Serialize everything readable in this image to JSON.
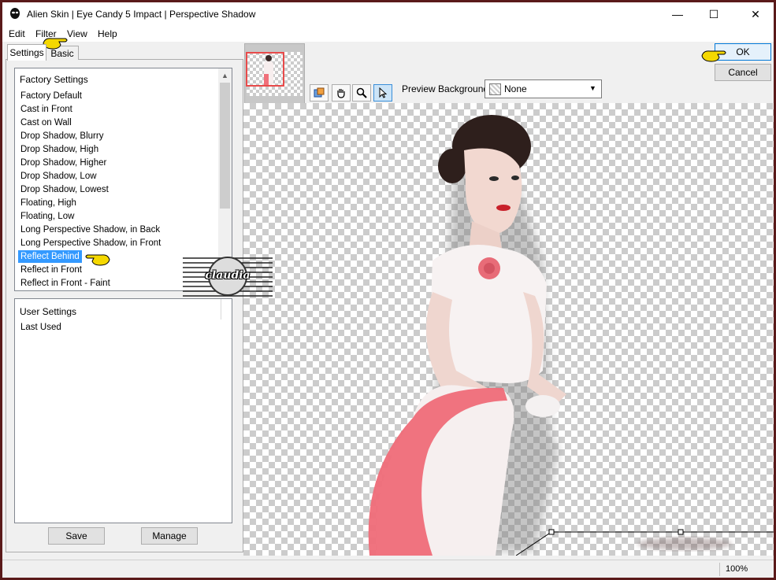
{
  "window": {
    "title": "Alien Skin | Eye Candy 5 Impact | Perspective Shadow",
    "controls": {
      "minimize": "—",
      "maximize": "☐",
      "close": "✕"
    }
  },
  "menu": [
    "Edit",
    "Filter",
    "View",
    "Help"
  ],
  "tabs": {
    "settings": "Settings",
    "basic": "Basic"
  },
  "factory": {
    "header": "Factory Settings",
    "items": [
      "Factory Default",
      "Cast in Front",
      "Cast on Wall",
      "Drop Shadow, Blurry",
      "Drop Shadow, High",
      "Drop Shadow, Higher",
      "Drop Shadow, Low",
      "Drop Shadow, Lowest",
      "Floating, High",
      "Floating, Low",
      "Long Perspective Shadow, in Back",
      "Long Perspective Shadow, in Front",
      "Reflect Behind",
      "Reflect in Front",
      "Reflect in Front - Faint"
    ],
    "selected": "Reflect Behind"
  },
  "user": {
    "header": "User Settings",
    "items": [
      "Last Used"
    ]
  },
  "buttons": {
    "save": "Save",
    "manage": "Manage",
    "ok": "OK",
    "cancel": "Cancel"
  },
  "preview": {
    "background_label": "Preview Background:",
    "background_value": "None"
  },
  "status": {
    "zoom": "100%"
  },
  "watermark": "claudia",
  "colors": {
    "selection": "#3399ff",
    "pointer": "#f5d800",
    "thumb_border": "#e84a4a"
  }
}
